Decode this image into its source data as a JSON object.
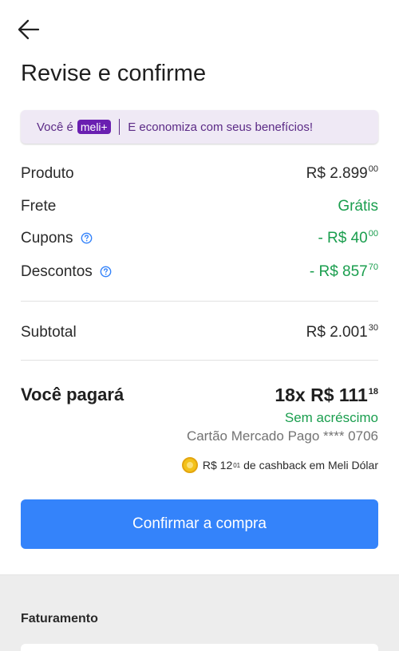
{
  "header": {
    "title": "Revise e confirme"
  },
  "banner": {
    "prefix": "Você é",
    "brand": "meli+",
    "text": "E economiza com seus benefícios!"
  },
  "summary": {
    "produto": {
      "label": "Produto",
      "value": "R$ 2.899",
      "cents": "00"
    },
    "frete": {
      "label": "Frete",
      "value": "Grátis"
    },
    "cupons": {
      "label": "Cupons",
      "value": "- R$ 40",
      "cents": "00"
    },
    "descontos": {
      "label": "Descontos",
      "value": "- R$ 857",
      "cents": "70"
    },
    "subtotal": {
      "label": "Subtotal",
      "value": "R$ 2.001",
      "cents": "30"
    }
  },
  "payment": {
    "label": "Você pagará",
    "installments": "18x R$ 111",
    "installment_cents": "18",
    "no_fee": "Sem acréscimo",
    "card": "Cartão Mercado Pago **** 0706"
  },
  "cashback": {
    "amount": "R$ 12",
    "cents": "01",
    "text": "de cashback em Meli Dólar"
  },
  "actions": {
    "confirm_label": "Confirmar a compra"
  },
  "billing": {
    "title": "Faturamento"
  },
  "colors": {
    "accent": "#3483fa",
    "success": "#1a9e4e",
    "brand_purple": "#6a1fb1"
  }
}
